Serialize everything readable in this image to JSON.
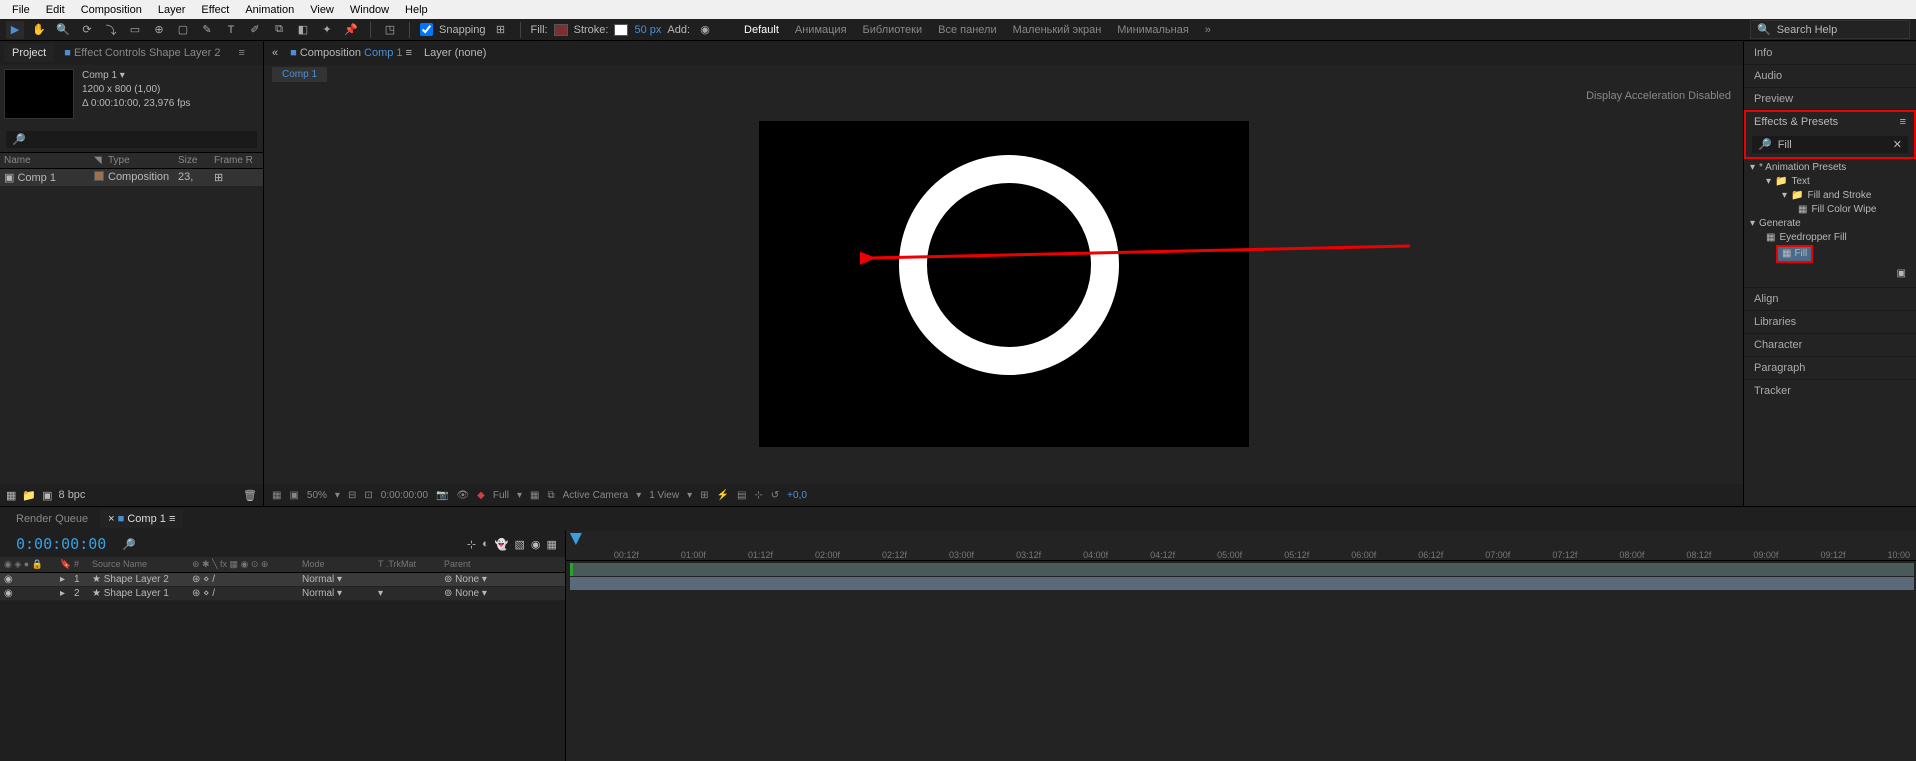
{
  "menu": {
    "file": "File",
    "edit": "Edit",
    "composition": "Composition",
    "layer": "Layer",
    "effect": "Effect",
    "animation": "Animation",
    "view": "View",
    "window": "Window",
    "help": "Help"
  },
  "toolbar": {
    "snapping": "Snapping",
    "fill": "Fill:",
    "stroke": "Stroke:",
    "stroke_px": "50 px",
    "add": "Add:"
  },
  "workspaces": {
    "default": "Default",
    "animation": "Анимация",
    "libraries": "Библиотеки",
    "all_panels": "Все панели",
    "small_screen": "Маленький экран",
    "minimal": "Минимальная"
  },
  "search_help_placeholder": "Search Help",
  "project": {
    "tab_project": "Project",
    "tab_effect_controls": "Effect Controls Shape Layer 2",
    "comp_name": "Comp 1",
    "dims": "1200 x 800 (1,00)",
    "duration": "Δ 0:00:10:00, 23,976 fps",
    "headers": {
      "name": "Name",
      "type": "Type",
      "size": "Size",
      "frame": "Frame R"
    },
    "row": {
      "name": "Comp 1",
      "type": "Composition",
      "size": "23,"
    },
    "bpc": "8 bpc"
  },
  "composition": {
    "tab_label": "Composition",
    "comp_link": "Comp 1",
    "layer_tab": "Layer (none)",
    "subtab": "Comp 1",
    "accel": "Display Acceleration Disabled",
    "footer": {
      "zoom": "50%",
      "time": "0:00:00:00",
      "res": "Full",
      "camera": "Active Camera",
      "views": "1 View",
      "exposure": "+0,0"
    }
  },
  "right_panels": {
    "info": "Info",
    "audio": "Audio",
    "preview": "Preview",
    "effects_presets": "Effects & Presets",
    "search_value": "Fill",
    "animation_presets": "* Animation Presets",
    "text": "Text",
    "fill_and_stroke": "Fill and Stroke",
    "fill_color_wipe": "Fill Color Wipe",
    "generate": "Generate",
    "eyedropper_fill": "Eyedropper Fill",
    "fill": "Fill",
    "align": "Align",
    "libraries": "Libraries",
    "character": "Character",
    "paragraph": "Paragraph",
    "tracker": "Tracker"
  },
  "timeline": {
    "render_queue": "Render Queue",
    "comp_tab": "Comp 1",
    "time": "0:00:00:00",
    "headers": {
      "source": "Source Name",
      "mode": "Mode",
      "trkmat": "T  .TrkMat",
      "parent": "Parent"
    },
    "layer1": {
      "num": "1",
      "name": "Shape Layer 2",
      "mode": "Normal",
      "parent": "None"
    },
    "layer2": {
      "num": "2",
      "name": "Shape Layer 1",
      "mode": "Normal",
      "parent": "None"
    },
    "ticks": [
      "",
      "00:12f",
      "01:00f",
      "01:12f",
      "02:00f",
      "02:12f",
      "03:00f",
      "03:12f",
      "04:00f",
      "04:12f",
      "05:00f",
      "05:12f",
      "06:00f",
      "06:12f",
      "07:00f",
      "07:12f",
      "08:00f",
      "08:12f",
      "09:00f",
      "09:12f",
      "10:00"
    ]
  }
}
